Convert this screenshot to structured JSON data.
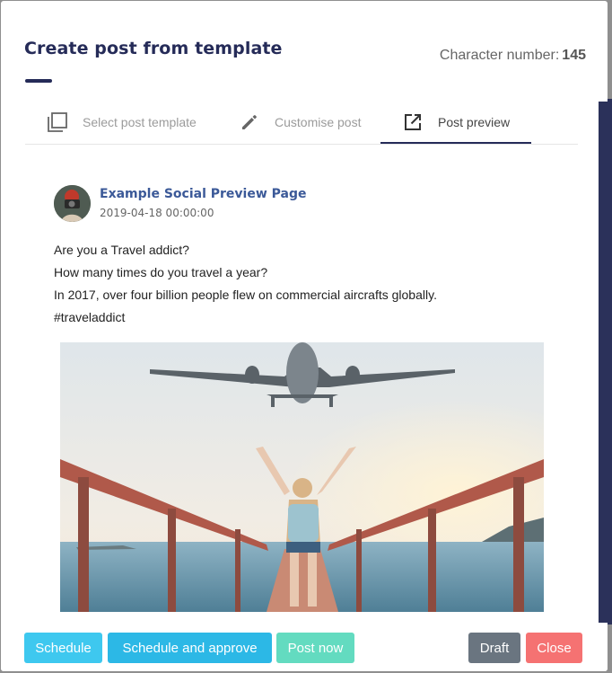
{
  "header": {
    "title": "Create post from template",
    "char_label": "Character number:",
    "char_count": "145"
  },
  "tabs": [
    {
      "label": "Select post template",
      "icon": "template-copy-icon",
      "active": false
    },
    {
      "label": "Customise post",
      "icon": "pencil-icon",
      "active": false
    },
    {
      "label": "Post preview",
      "icon": "open-external-icon",
      "active": true
    }
  ],
  "preview": {
    "page_name": "Example Social Preview Page",
    "date": "2019-04-18 00:00:00",
    "lines": [
      "Are you a Travel addict?",
      "How many times do you travel a year?",
      "In 2017, over four billion people flew on commercial aircrafts globally.",
      "#traveladdict"
    ]
  },
  "footer": {
    "schedule": "Schedule",
    "schedule_approve": "Schedule and approve",
    "post_now": "Post now",
    "draft": "Draft",
    "close": "Close"
  },
  "colors": {
    "title": "#252b58",
    "link": "#3b5998",
    "schedule": "#3ec8ef",
    "schedule_approve": "#2cb8e6",
    "post_now": "#63dbc0",
    "draft": "#6a7580",
    "close": "#f57272"
  }
}
